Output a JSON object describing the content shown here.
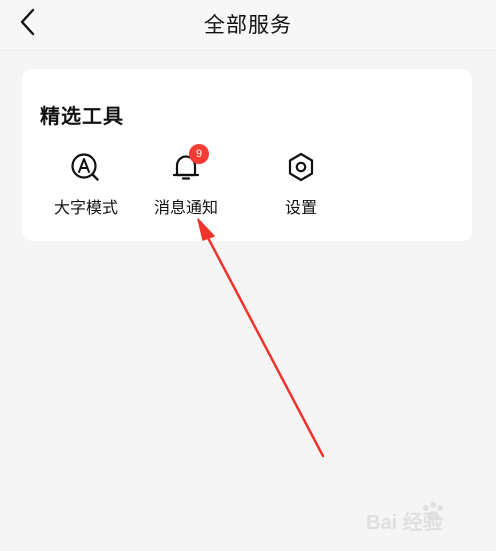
{
  "header": {
    "title": "全部服务",
    "back_icon": "chevron-left-icon"
  },
  "featured_tools": {
    "title": "精选工具",
    "items": [
      {
        "label": "大字模式",
        "icon": "large-font-icon"
      },
      {
        "label": "消息通知",
        "icon": "bell-icon",
        "badge": "9"
      },
      {
        "label": "设置",
        "icon": "settings-hexagon-icon"
      }
    ]
  },
  "colors": {
    "background": "#f5f5f5",
    "card": "#ffffff",
    "badge": "#f53b33",
    "annotation_arrow": "#f0342c"
  },
  "watermark": {
    "text": "Bai 经验"
  }
}
